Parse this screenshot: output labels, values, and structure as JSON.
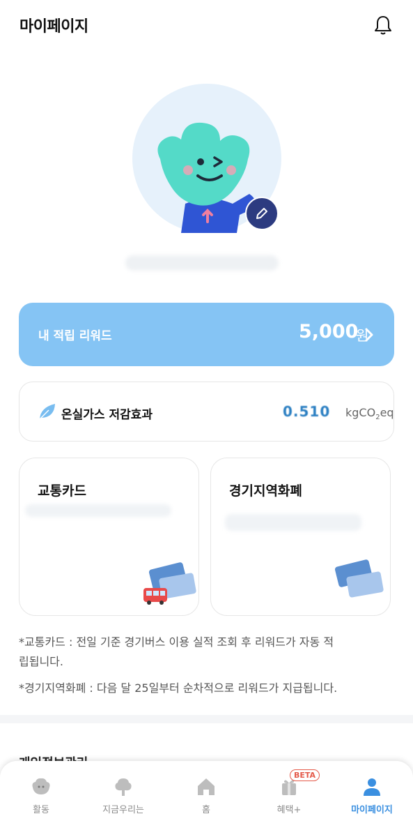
{
  "header": {
    "title": "마이페이지"
  },
  "reward": {
    "label": "내 적립 리워드",
    "amount": "5,000",
    "unit": "원"
  },
  "ghg": {
    "label": "온실가스 저감효과",
    "value": "0.510",
    "unit": "kgCO",
    "unit_sub": "2",
    "unit_suffix": "eq"
  },
  "cards": {
    "transit": {
      "title": "교통카드"
    },
    "local": {
      "title": "경기지역화폐"
    }
  },
  "notes": {
    "transit": "*교통카드 : 전일 기준 경기버스 이용 실적 조회 후 리워드가 자동 적립됩니다.",
    "local": "*경기지역화폐 : 다음 달 25일부터 순차적으로 리워드가 지급됩니다."
  },
  "section_peek": "개인정보관리",
  "tabbar": {
    "items": [
      {
        "label": "활동",
        "icon": "mascot-icon"
      },
      {
        "label": "지금우리는",
        "icon": "tree-icon"
      },
      {
        "label": "홈",
        "icon": "home-icon"
      },
      {
        "label": "혜택+",
        "icon": "gift-icon"
      },
      {
        "label": "마이페이지",
        "icon": "person-icon"
      }
    ],
    "beta_badge": "BETA",
    "active_index": 4
  },
  "colors": {
    "accent": "#3a8fe0",
    "reward_bg": "#85c4f4",
    "inactive": "#8b8b8b",
    "beta": "#e45a4a"
  }
}
